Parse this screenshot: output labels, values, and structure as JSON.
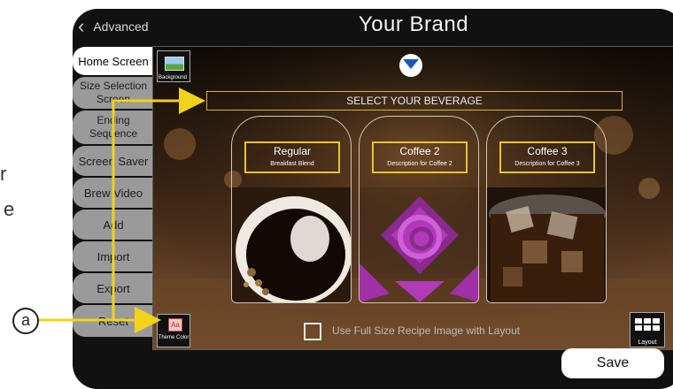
{
  "colors": {
    "accent_yellow": "#f2d21a",
    "label_border": "#e9c52c",
    "device_bg": "#111111",
    "tab_inactive": "#9a9a9a"
  },
  "stray_text": {
    "char1": "r",
    "char2": "e"
  },
  "topbar": {
    "back_label": "Advanced",
    "title": "Your Brand"
  },
  "tabs": [
    {
      "label": "Home Screen",
      "active": true
    },
    {
      "label": "Size Selection Screen",
      "active": false
    },
    {
      "label": "Ending Sequence",
      "active": false
    },
    {
      "label": "Screen Saver",
      "active": false
    },
    {
      "label": "Brew Video",
      "active": false
    },
    {
      "label": "Add",
      "active": false
    },
    {
      "label": "Import",
      "active": false
    },
    {
      "label": "Export",
      "active": false
    },
    {
      "label": "Reset",
      "active": false
    }
  ],
  "main": {
    "background_button_label": "Background",
    "select_title": "SELECT YOUR BEVERAGE",
    "beverages": [
      {
        "name": "Regular",
        "description": "Breakfast Blend",
        "image_icon": "black-coffee-cup-image"
      },
      {
        "name": "Coffee 2",
        "description": "Description for Coffee 2",
        "image_icon": "purple-spiral-placeholder-image"
      },
      {
        "name": "Coffee 3",
        "description": "Description for Coffee 3",
        "image_icon": "iced-coffee-image"
      }
    ],
    "theme_button_label": "Theme Color",
    "fullsize_checkbox_label": "Use Full Size Recipe Image with Layout",
    "fullsize_checked": false,
    "layout_button_label": "Layout"
  },
  "footer": {
    "save_label": "Save"
  },
  "callout": {
    "label": "a"
  }
}
